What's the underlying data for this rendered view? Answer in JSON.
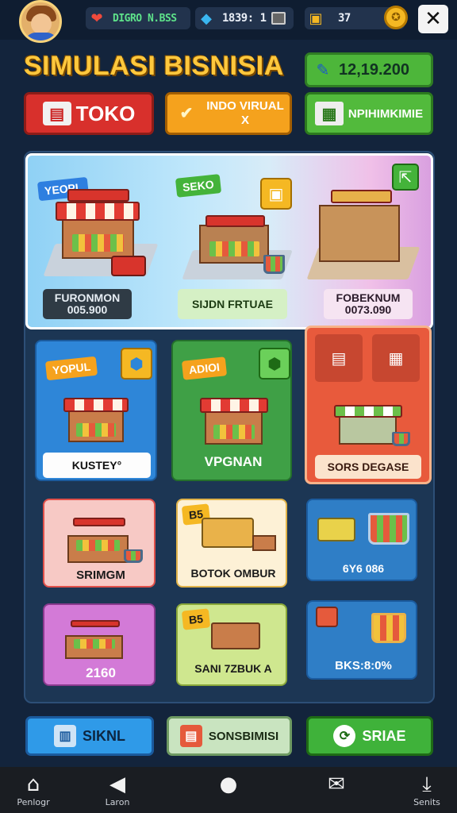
{
  "topbar": {
    "resources": [
      {
        "icon": "heart-icon",
        "text": "DIGRO N.BSS"
      },
      {
        "icon": "lightning-icon",
        "text": "1839: 1"
      },
      {
        "icon": "coin-stack-icon",
        "text": "37"
      }
    ],
    "close_label": "✕"
  },
  "header": {
    "title": "SIMULASI BISNISIA",
    "money": "12,19.200"
  },
  "tabs": {
    "toko": "TOKO",
    "virtual": "INDO VIRUAL X",
    "peng": "NPIHIMKIMIE"
  },
  "cards": {
    "row1": [
      {
        "tag": "YEOPL",
        "caption": "FURONMON",
        "sub": "005.900"
      },
      {
        "tag": "SEKO",
        "caption": "SIJDN FRTUAE",
        "sub": ""
      },
      {
        "tag": "",
        "caption": "FOBEKNUM",
        "sub": "0073.090"
      }
    ],
    "row2": [
      {
        "tag": "YOPUL",
        "caption": "KUSTEY°"
      },
      {
        "tag": "ADIOI",
        "caption": "VPGNAN"
      },
      {
        "tag": "",
        "caption": "SORS DEGASE"
      }
    ],
    "row3": [
      {
        "caption": "SRIMGM"
      },
      {
        "tag": "B5",
        "caption": "BOTOK OMBUR"
      },
      {
        "caption": "6Y6 086"
      }
    ],
    "row4": [
      {
        "caption": "2160"
      },
      {
        "tag": "B5",
        "caption": "SANI 7ZBUK A"
      },
      {
        "caption": "BKS:8:0%"
      }
    ]
  },
  "bottom_buttons": {
    "left": "SIKNL",
    "middle": "SONSBIMISI",
    "right": "SRIAE"
  },
  "navbar": [
    {
      "icon": "home-icon",
      "label": "Penlogr"
    },
    {
      "icon": "back-icon",
      "label": "Laron"
    },
    {
      "icon": "circle-home-icon",
      "label": ""
    },
    {
      "icon": "mail-icon",
      "label": ""
    },
    {
      "icon": "download-icon",
      "label": "Senits"
    }
  ]
}
